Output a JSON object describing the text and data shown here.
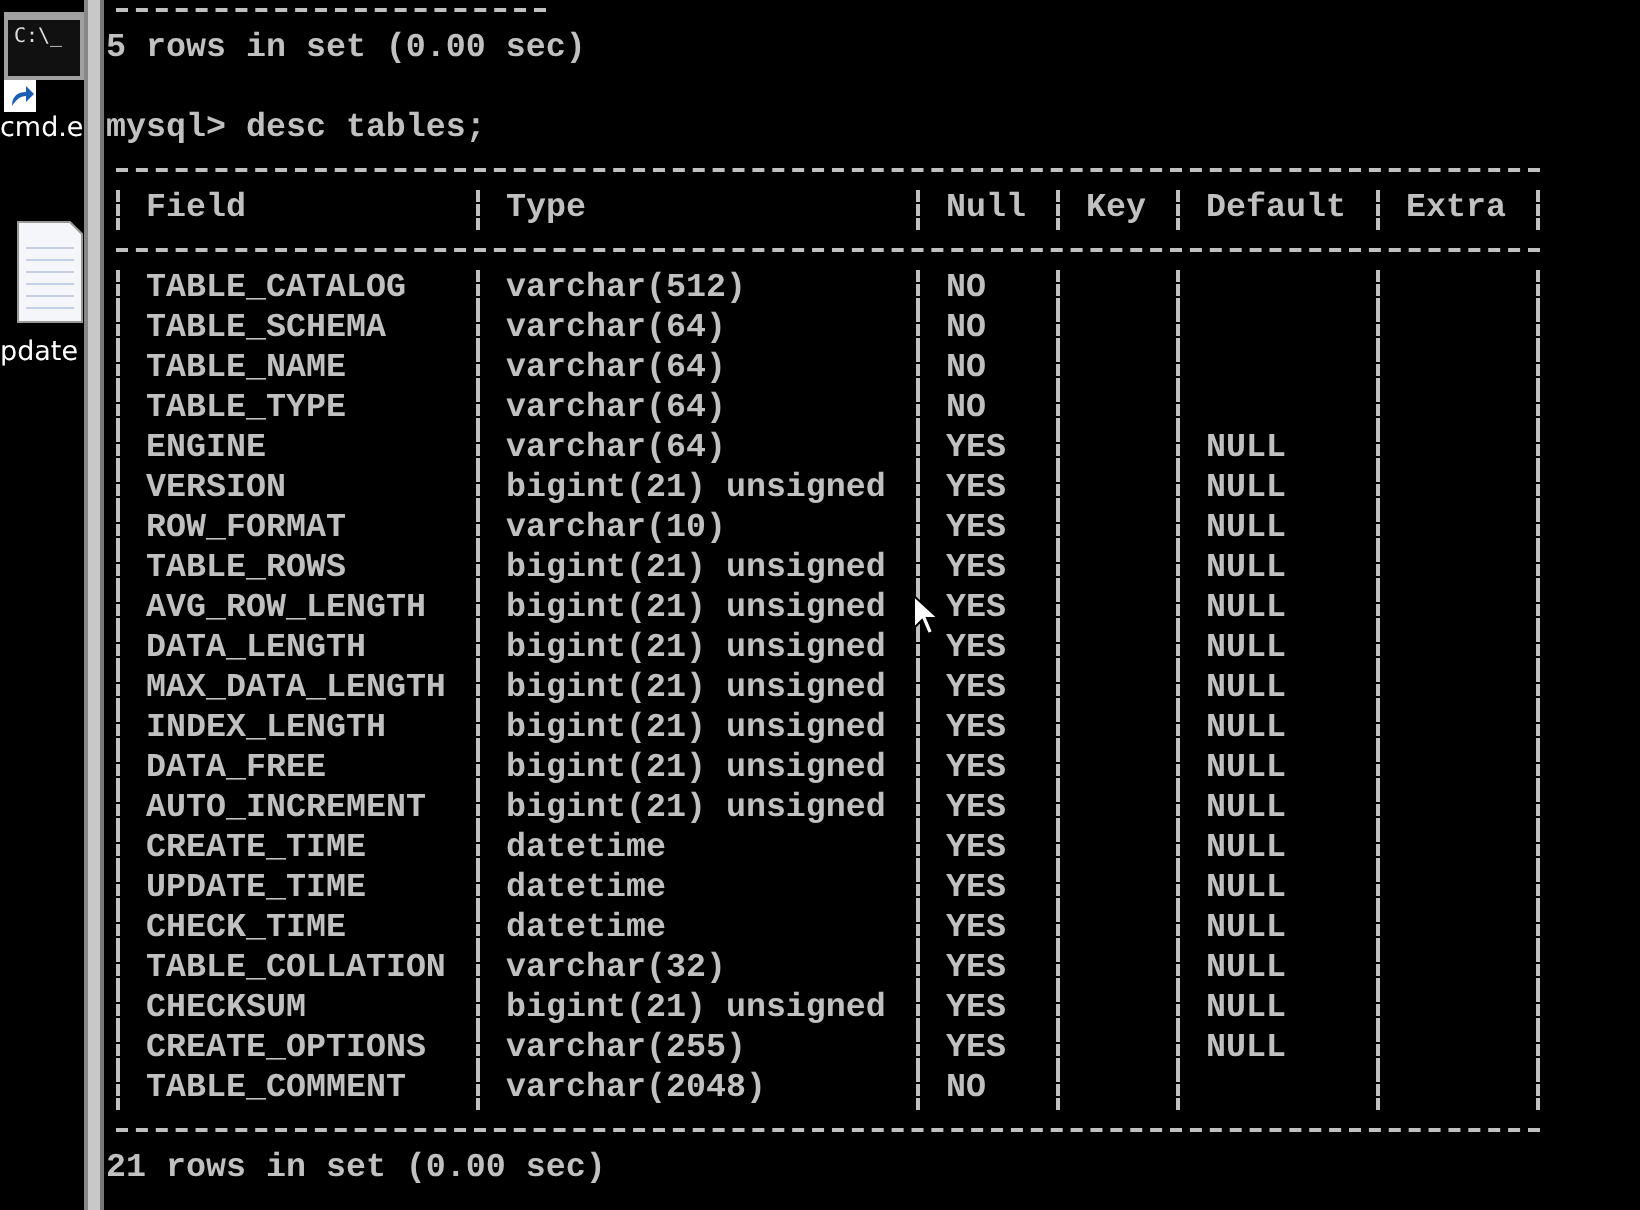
{
  "desktop": {
    "icons": [
      {
        "kind": "console",
        "glyph": "C:\\_",
        "label": "cmd.e"
      },
      {
        "kind": "document",
        "label": "pdate"
      }
    ]
  },
  "terminal": {
    "before": [
      {
        "kind": "rule"
      },
      {
        "kind": "text",
        "text": "5 rows in set (0.00 sec)"
      },
      {
        "kind": "blank"
      },
      {
        "kind": "text",
        "text": "mysql> desc tables;"
      }
    ],
    "table": {
      "columns": [
        "Field",
        "Type",
        "Null",
        "Key",
        "Default",
        "Extra"
      ],
      "rows": [
        {
          "field": "TABLE_CATALOG",
          "type": "varchar(512)",
          "null": "NO"
        },
        {
          "field": "TABLE_SCHEMA",
          "type": "varchar(64)",
          "null": "NO"
        },
        {
          "field": "TABLE_NAME",
          "type": "varchar(64)",
          "null": "NO"
        },
        {
          "field": "TABLE_TYPE",
          "type": "varchar(64)",
          "null": "NO"
        },
        {
          "field": "ENGINE",
          "type": "varchar(64)",
          "null": "YES",
          "default": "NULL"
        },
        {
          "field": "VERSION",
          "type": "bigint(21) unsigned",
          "null": "YES",
          "default": "NULL"
        },
        {
          "field": "ROW_FORMAT",
          "type": "varchar(10)",
          "null": "YES",
          "default": "NULL"
        },
        {
          "field": "TABLE_ROWS",
          "type": "bigint(21) unsigned",
          "null": "YES",
          "default": "NULL"
        },
        {
          "field": "AVG_ROW_LENGTH",
          "type": "bigint(21) unsigned",
          "null": "YES",
          "default": "NULL"
        },
        {
          "field": "DATA_LENGTH",
          "type": "bigint(21) unsigned",
          "null": "YES",
          "default": "NULL"
        },
        {
          "field": "MAX_DATA_LENGTH",
          "type": "bigint(21) unsigned",
          "null": "YES",
          "default": "NULL"
        },
        {
          "field": "INDEX_LENGTH",
          "type": "bigint(21) unsigned",
          "null": "YES",
          "default": "NULL"
        },
        {
          "field": "DATA_FREE",
          "type": "bigint(21) unsigned",
          "null": "YES",
          "default": "NULL"
        },
        {
          "field": "AUTO_INCREMENT",
          "type": "bigint(21) unsigned",
          "null": "YES",
          "default": "NULL"
        },
        {
          "field": "CREATE_TIME",
          "type": "datetime",
          "null": "YES",
          "default": "NULL"
        },
        {
          "field": "UPDATE_TIME",
          "type": "datetime",
          "null": "YES",
          "default": "NULL"
        },
        {
          "field": "CHECK_TIME",
          "type": "datetime",
          "null": "YES",
          "default": "NULL"
        },
        {
          "field": "TABLE_COLLATION",
          "type": "varchar(32)",
          "null": "YES",
          "default": "NULL"
        },
        {
          "field": "CHECKSUM",
          "type": "bigint(21) unsigned",
          "null": "YES",
          "default": "NULL"
        },
        {
          "field": "CREATE_OPTIONS",
          "type": "varchar(255)",
          "null": "YES",
          "default": "NULL"
        },
        {
          "field": "TABLE_COMMENT",
          "type": "varchar(2048)",
          "null": "NO"
        }
      ]
    },
    "after": "21 rows in set (0.00 sec)"
  }
}
